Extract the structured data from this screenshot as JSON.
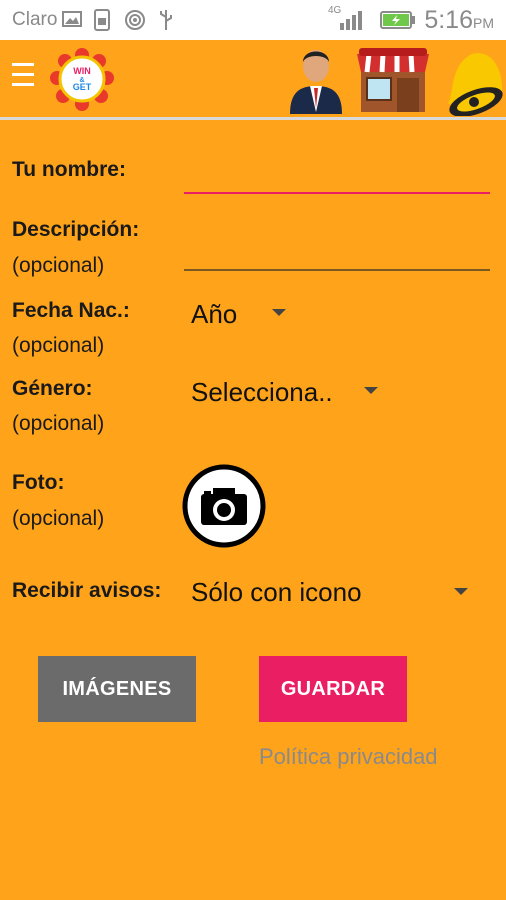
{
  "status_bar": {
    "carrier": "Claro",
    "network": "4G",
    "time": "5:16",
    "ampm": "PM"
  },
  "app_bar": {
    "logo_text_1": "WIN",
    "logo_text_2": "&",
    "logo_text_3": "GET"
  },
  "form": {
    "name_label": "Tu nombre:",
    "description_label": "Descripción:",
    "description_sub": "(opcional)",
    "birth_label": "Fecha Nac.:",
    "birth_sub": "(opcional)",
    "birth_value": "Año",
    "gender_label": "Género:",
    "gender_sub": "(opcional)",
    "gender_value": "Selecciona..",
    "photo_label": "Foto:",
    "photo_sub": "(opcional)",
    "notify_label": "Recibir avisos:",
    "notify_value": "Sólo con icono"
  },
  "buttons": {
    "images": "IMÁGENES",
    "save": "GUARDAR"
  },
  "privacy_link": "Política privacidad",
  "colors": {
    "background": "#ffa31a",
    "save_button": "#e91e63",
    "images_button": "#6b6b6b",
    "name_underline": "#e91e63"
  }
}
